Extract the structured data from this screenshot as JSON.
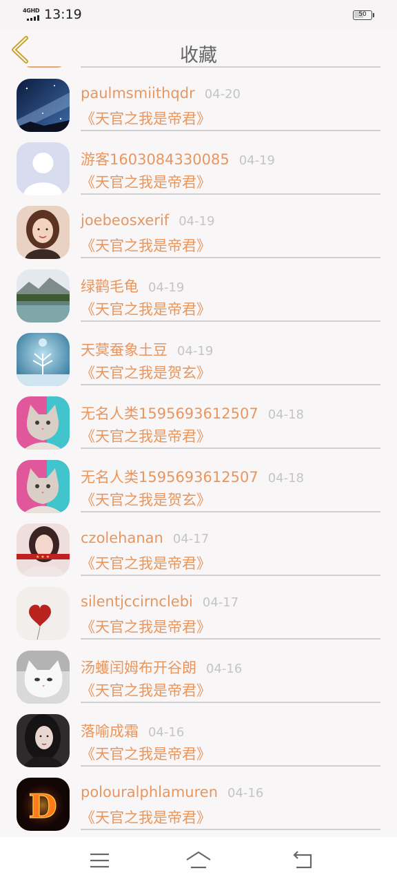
{
  "status_bar": {
    "network": "4GHD",
    "time": "13:19",
    "battery": "50"
  },
  "header": {
    "title": "收藏",
    "back_icon": "chevron-left-icon"
  },
  "colors": {
    "accent": "#e8965e",
    "date": "#c4c4c4",
    "separator": "#d0cfd0",
    "back_icon": "#c9a227"
  },
  "list": {
    "items": [
      {
        "name": "paulmsmiithqdr",
        "date": "04-20",
        "book": "《天官之我是帝君》",
        "avatar": "starry-night-avatar"
      },
      {
        "name": "游客1603084330085",
        "date": "04-19",
        "book": "《天官之我是帝君》",
        "avatar": "default-user-avatar"
      },
      {
        "name": "joebeosxerif",
        "date": "04-19",
        "book": "《天官之我是帝君》",
        "avatar": "girl-photo-avatar"
      },
      {
        "name": "绿鹳毛龟",
        "date": "04-19",
        "book": "《天官之我是帝君》",
        "avatar": "lake-landscape-avatar"
      },
      {
        "name": "天蓂蚕象土豆",
        "date": "04-19",
        "book": "《天官之我是贺玄》",
        "avatar": "snow-globe-tree-avatar"
      },
      {
        "name": "无名人类1595693612507",
        "date": "04-18",
        "book": "《天官之我是帝君》",
        "avatar": "kitten-avatar"
      },
      {
        "name": "无名人类1595693612507",
        "date": "04-18",
        "book": "《天官之我是贺玄》",
        "avatar": "kitten-avatar"
      },
      {
        "name": "czolehanan",
        "date": "04-17",
        "book": "《天官之我是帝君》",
        "avatar": "woman-photo-avatar"
      },
      {
        "name": "silentjccirnclebi",
        "date": "04-17",
        "book": "《天官之我是帝君》",
        "avatar": "red-heart-avatar"
      },
      {
        "name": "汤蠖闰姆布开谷朗",
        "date": "04-16",
        "book": "《天官之我是帝君》",
        "avatar": "white-cat-avatar"
      },
      {
        "name": "落喻成霜",
        "date": "04-16",
        "book": "《天官之我是帝君》",
        "avatar": "dark-hair-woman-avatar"
      },
      {
        "name": "polouralphlamuren",
        "date": "04-16",
        "book": "《天官之我是帝君》",
        "avatar": "fire-letter-d-avatar"
      }
    ]
  },
  "nav_bar": {
    "menu_icon": "menu-icon",
    "home_icon": "home-icon",
    "back_icon": "back-arrow-icon"
  }
}
